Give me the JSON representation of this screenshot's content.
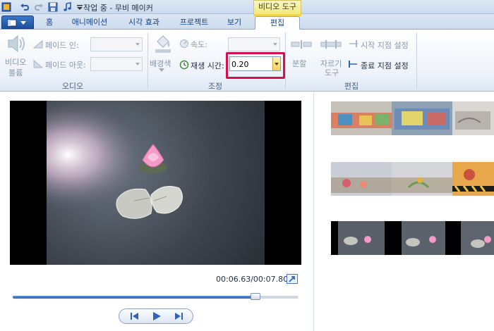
{
  "window": {
    "title": "작업 중 - 무비 메이커",
    "context_tab_header": "비디오 도구"
  },
  "tabs": [
    {
      "label": "홈"
    },
    {
      "label": "애니메이션"
    },
    {
      "label": "시각 효과"
    },
    {
      "label": "프로젝트"
    },
    {
      "label": "보기"
    },
    {
      "label": "편집",
      "active": true
    }
  ],
  "ribbon": {
    "audio": {
      "volume_label_line1": "비디오",
      "volume_label_line2": "볼륨",
      "fade_in_label": "페이드 인:",
      "fade_out_label": "페이드 아웃:",
      "group_label": "오디오"
    },
    "adjust": {
      "background_color_label": "배경색",
      "speed_label": "속도:",
      "duration_label": "재생 시간:",
      "duration_value": "0.20",
      "group_label": "조정"
    },
    "edit": {
      "split_label": "분할",
      "trim_tool_line1": "자르기",
      "trim_tool_line2": "도구",
      "set_start_point": "시작 지점 설정",
      "set_end_point": "종료 지점 설정",
      "group_label": "편집"
    }
  },
  "preview": {
    "time": "00:06.63/00:07.80",
    "progress": 0.85
  },
  "colors": {
    "highlight": "#d4114d",
    "accent": "#2f64b3",
    "context_tab": "#f4e97a"
  }
}
